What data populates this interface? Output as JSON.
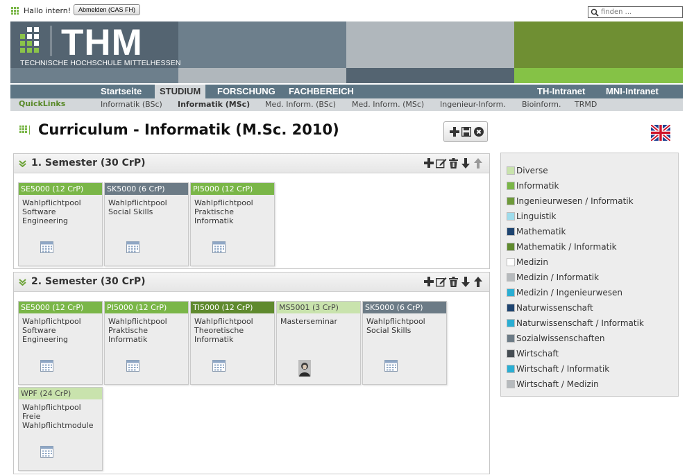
{
  "header": {
    "greeting": "Hallo intern!",
    "logout_label": "Abmelden (CAS FH)",
    "search_placeholder": "finden ..."
  },
  "banner": {
    "logo_text": "THM",
    "logo_subtitle": "TECHNISCHE HOCHSCHULE MITTELHESSEN",
    "colors": {
      "dark": "#546471",
      "mid": "#6d7f8c",
      "light": "#b0b7bc",
      "green": "#6f8f33",
      "accent_green": "#85c246"
    }
  },
  "nav": {
    "main": [
      "Startseite",
      "STUDIUM",
      "FORSCHUNG",
      "FACHBEREICH",
      "TH-Intranet",
      "MNI-Intranet"
    ],
    "active": "STUDIUM",
    "quicklinks_label": "QuickLinks",
    "sub": [
      "Informatik (BSc)",
      "Informatik (MSc)",
      "Med. Inform. (BSc)",
      "Med. Inform. (MSc)",
      "Ingenieur-Inform.",
      "Bioinform.",
      "TRMD"
    ],
    "sub_active": "Informatik (MSc)"
  },
  "page": {
    "title": "Curriculum - Informatik (M.Sc. 2010)",
    "tools": [
      "add-icon",
      "save-icon",
      "close-icon"
    ],
    "language_flag": "uk-flag-icon"
  },
  "semesters": [
    {
      "title": "1. Semester (30 CrP)",
      "tools": [
        "add-icon",
        "edit-icon",
        "delete-icon",
        "arrow-down-icon",
        "arrow-up-icon"
      ],
      "modules": [
        {
          "code": "SE5000 (12 CrP)",
          "color": "#7ab648",
          "lines": [
            "Wahlpflichtpool",
            "Software",
            "Engineering"
          ],
          "icon": "calendar-icon"
        },
        {
          "code": "SK5000 (6 CrP)",
          "color": "#6c7b86",
          "lines": [
            "Wahlpflichtpool",
            "Social Skills"
          ],
          "icon": "calendar-icon"
        },
        {
          "code": "PI5000 (12 CrP)",
          "color": "#7ab648",
          "lines": [
            "Wahlpflichtpool",
            "Praktische",
            "Informatik"
          ],
          "icon": "calendar-icon"
        }
      ]
    },
    {
      "title": "2. Semester (30 CrP)",
      "tools": [
        "add-icon",
        "edit-icon",
        "delete-icon",
        "arrow-down-icon",
        "arrow-up-icon"
      ],
      "modules": [
        {
          "code": "SE5000 (12 CrP)",
          "color": "#7ab648",
          "lines": [
            "Wahlpflichtpool",
            "Software",
            "Engineering"
          ],
          "icon": "calendar-icon"
        },
        {
          "code": "PI5000 (12 CrP)",
          "color": "#7ab648",
          "lines": [
            "Wahlpflichtpool",
            "Praktische",
            "Informatik"
          ],
          "icon": "calendar-icon"
        },
        {
          "code": "TI5000 (12 CrP)",
          "color": "#5f8a2e",
          "lines": [
            "Wahlpflichtpool",
            "Theoretische",
            "Informatik"
          ],
          "icon": "calendar-icon"
        },
        {
          "code": "MS5001 (3 CrP)",
          "color": "#c9e3ad",
          "lines": [
            "Masterseminar"
          ],
          "icon": "person-photo-icon"
        },
        {
          "code": "SK5000 (6 CrP)",
          "color": "#6c7b86",
          "lines": [
            "Wahlpflichtpool",
            "Social Skills"
          ],
          "icon": "calendar-icon"
        },
        {
          "code": "WPF (24 CrP)",
          "color": "#c9e3ad",
          "lines": [
            "Wahlpflichtpool",
            "Freie",
            "Wahlpflichtmodule"
          ],
          "icon": "calendar-icon"
        }
      ]
    }
  ],
  "legend": [
    {
      "label": "Diverse",
      "color": "#c9e3ad"
    },
    {
      "label": "Informatik",
      "color": "#7ab648"
    },
    {
      "label": "Ingenieurwesen / Informatik",
      "color": "#6e9a3a"
    },
    {
      "label": "Linguistik",
      "color": "#9edcec"
    },
    {
      "label": "Mathematik",
      "color": "#1e4470"
    },
    {
      "label": "Mathematik / Informatik",
      "color": "#5f8a2e"
    },
    {
      "label": "Medizin",
      "color": "#ffffff"
    },
    {
      "label": "Medizin / Informatik",
      "color": "#b6babd"
    },
    {
      "label": "Medizin / Ingenieurwesen",
      "color": "#2aaed3"
    },
    {
      "label": "Naturwissenschaft",
      "color": "#1e4470"
    },
    {
      "label": "Naturwissenschaft / Informatik",
      "color": "#2aaed3"
    },
    {
      "label": "Sozialwissenschaften",
      "color": "#6c7b86"
    },
    {
      "label": "Wirtschaft",
      "color": "#454c52"
    },
    {
      "label": "Wirtschaft / Informatik",
      "color": "#2aaed3"
    },
    {
      "label": "Wirtschaft / Medizin",
      "color": "#b6babd"
    }
  ]
}
